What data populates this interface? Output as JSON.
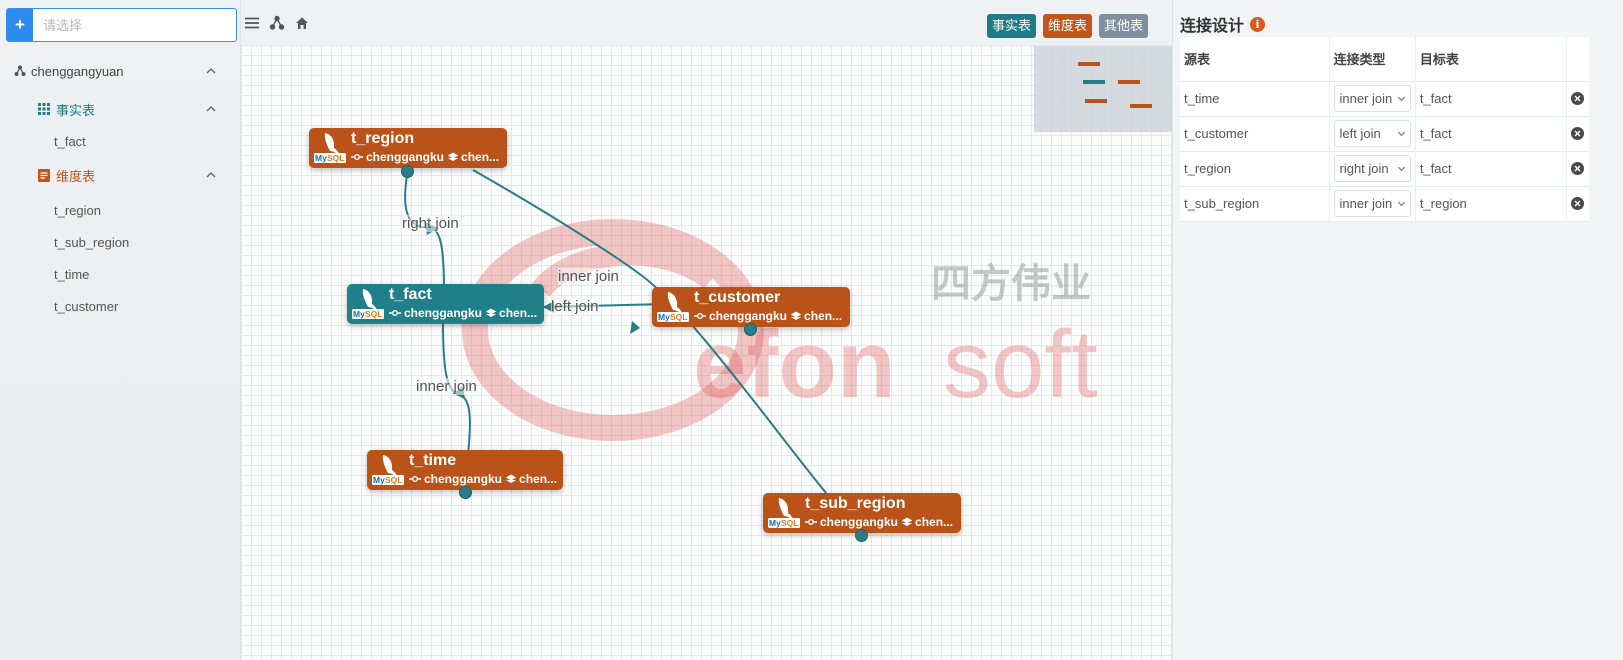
{
  "sidebar": {
    "add_label": "+",
    "search_placeholder": "请选择",
    "root": {
      "label": "chenggangyuan"
    },
    "fact_group": {
      "label": "事实表",
      "items": [
        {
          "label": "t_fact"
        }
      ]
    },
    "dim_group": {
      "label": "维度表",
      "items": [
        {
          "label": "t_region"
        },
        {
          "label": "t_sub_region"
        },
        {
          "label": "t_time"
        },
        {
          "label": "t_customer"
        }
      ]
    }
  },
  "toolbar": {
    "legend": [
      {
        "label": "事实表",
        "color": "#1f7c84"
      },
      {
        "label": "维度表",
        "color": "#c0561b"
      },
      {
        "label": "其他表",
        "color": "#7f8fa0"
      }
    ]
  },
  "colors": {
    "fact": "#20808a",
    "dimension": "#b9531a",
    "edge": "#2c7c88"
  },
  "watermark": {
    "brand_cn": "四方伟业",
    "brand_part1": "efon",
    "brand_part2": "soft"
  },
  "nodes": [
    {
      "id": "t_region",
      "name": "t_region",
      "type": "dimension",
      "db": "chenggangku",
      "schema": "chen..."
    },
    {
      "id": "t_fact",
      "name": "t_fact",
      "type": "fact",
      "db": "chenggangku",
      "schema": "chen..."
    },
    {
      "id": "t_customer",
      "name": "t_customer",
      "type": "dimension",
      "db": "chenggangku",
      "schema": "chen..."
    },
    {
      "id": "t_time",
      "name": "t_time",
      "type": "dimension",
      "db": "chenggangku",
      "schema": "chen..."
    },
    {
      "id": "t_sub_region",
      "name": "t_sub_region",
      "type": "dimension",
      "db": "chenggangku",
      "schema": "chen..."
    }
  ],
  "edge_labels": [
    "right join",
    "inner join",
    "left join",
    "inner join"
  ],
  "panel": {
    "title": "连接设计",
    "info_icon": "info-icon",
    "columns": {
      "source": "源表",
      "join_type": "连接类型",
      "target": "目标表"
    },
    "rows": [
      {
        "source": "t_time",
        "join_type": "inner join",
        "target": "t_fact"
      },
      {
        "source": "t_customer",
        "join_type": "left join",
        "target": "t_fact"
      },
      {
        "source": "t_region",
        "join_type": "right join",
        "target": "t_fact"
      },
      {
        "source": "t_sub_region",
        "join_type": "inner join",
        "target": "t_region"
      }
    ]
  }
}
